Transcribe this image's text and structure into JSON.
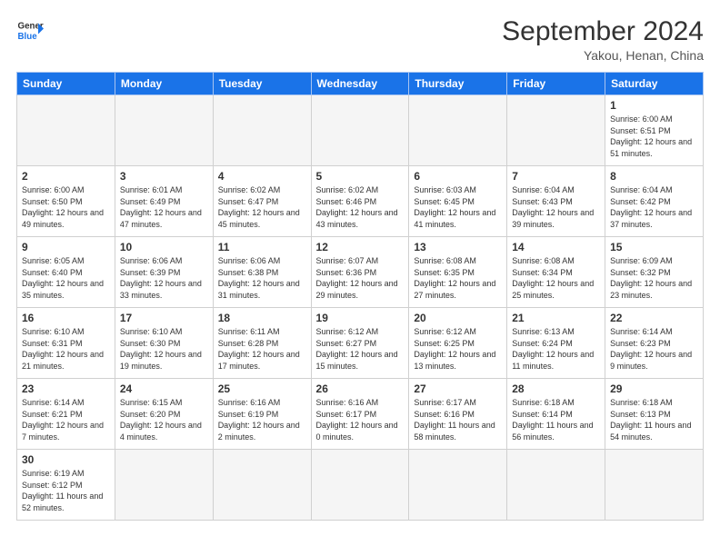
{
  "header": {
    "logo_line1": "General",
    "logo_line2": "Blue",
    "title": "September 2024",
    "subtitle": "Yakou, Henan, China"
  },
  "weekdays": [
    "Sunday",
    "Monday",
    "Tuesday",
    "Wednesday",
    "Thursday",
    "Friday",
    "Saturday"
  ],
  "days": [
    {
      "num": "",
      "empty": true
    },
    {
      "num": "",
      "empty": true
    },
    {
      "num": "",
      "empty": true
    },
    {
      "num": "",
      "empty": true
    },
    {
      "num": "",
      "empty": true
    },
    {
      "num": "",
      "empty": true
    },
    {
      "num": "1",
      "sunrise": "6:00 AM",
      "sunset": "6:51 PM",
      "daylight": "12 hours and 51 minutes."
    },
    {
      "num": "2",
      "sunrise": "6:00 AM",
      "sunset": "6:50 PM",
      "daylight": "12 hours and 49 minutes."
    },
    {
      "num": "3",
      "sunrise": "6:01 AM",
      "sunset": "6:49 PM",
      "daylight": "12 hours and 47 minutes."
    },
    {
      "num": "4",
      "sunrise": "6:02 AM",
      "sunset": "6:47 PM",
      "daylight": "12 hours and 45 minutes."
    },
    {
      "num": "5",
      "sunrise": "6:02 AM",
      "sunset": "6:46 PM",
      "daylight": "12 hours and 43 minutes."
    },
    {
      "num": "6",
      "sunrise": "6:03 AM",
      "sunset": "6:45 PM",
      "daylight": "12 hours and 41 minutes."
    },
    {
      "num": "7",
      "sunrise": "6:04 AM",
      "sunset": "6:43 PM",
      "daylight": "12 hours and 39 minutes."
    },
    {
      "num": "8",
      "sunrise": "6:04 AM",
      "sunset": "6:42 PM",
      "daylight": "12 hours and 37 minutes."
    },
    {
      "num": "9",
      "sunrise": "6:05 AM",
      "sunset": "6:40 PM",
      "daylight": "12 hours and 35 minutes."
    },
    {
      "num": "10",
      "sunrise": "6:06 AM",
      "sunset": "6:39 PM",
      "daylight": "12 hours and 33 minutes."
    },
    {
      "num": "11",
      "sunrise": "6:06 AM",
      "sunset": "6:38 PM",
      "daylight": "12 hours and 31 minutes."
    },
    {
      "num": "12",
      "sunrise": "6:07 AM",
      "sunset": "6:36 PM",
      "daylight": "12 hours and 29 minutes."
    },
    {
      "num": "13",
      "sunrise": "6:08 AM",
      "sunset": "6:35 PM",
      "daylight": "12 hours and 27 minutes."
    },
    {
      "num": "14",
      "sunrise": "6:08 AM",
      "sunset": "6:34 PM",
      "daylight": "12 hours and 25 minutes."
    },
    {
      "num": "15",
      "sunrise": "6:09 AM",
      "sunset": "6:32 PM",
      "daylight": "12 hours and 23 minutes."
    },
    {
      "num": "16",
      "sunrise": "6:10 AM",
      "sunset": "6:31 PM",
      "daylight": "12 hours and 21 minutes."
    },
    {
      "num": "17",
      "sunrise": "6:10 AM",
      "sunset": "6:30 PM",
      "daylight": "12 hours and 19 minutes."
    },
    {
      "num": "18",
      "sunrise": "6:11 AM",
      "sunset": "6:28 PM",
      "daylight": "12 hours and 17 minutes."
    },
    {
      "num": "19",
      "sunrise": "6:12 AM",
      "sunset": "6:27 PM",
      "daylight": "12 hours and 15 minutes."
    },
    {
      "num": "20",
      "sunrise": "6:12 AM",
      "sunset": "6:25 PM",
      "daylight": "12 hours and 13 minutes."
    },
    {
      "num": "21",
      "sunrise": "6:13 AM",
      "sunset": "6:24 PM",
      "daylight": "12 hours and 11 minutes."
    },
    {
      "num": "22",
      "sunrise": "6:14 AM",
      "sunset": "6:23 PM",
      "daylight": "12 hours and 9 minutes."
    },
    {
      "num": "23",
      "sunrise": "6:14 AM",
      "sunset": "6:21 PM",
      "daylight": "12 hours and 7 minutes."
    },
    {
      "num": "24",
      "sunrise": "6:15 AM",
      "sunset": "6:20 PM",
      "daylight": "12 hours and 4 minutes."
    },
    {
      "num": "25",
      "sunrise": "6:16 AM",
      "sunset": "6:19 PM",
      "daylight": "12 hours and 2 minutes."
    },
    {
      "num": "26",
      "sunrise": "6:16 AM",
      "sunset": "6:17 PM",
      "daylight": "12 hours and 0 minutes."
    },
    {
      "num": "27",
      "sunrise": "6:17 AM",
      "sunset": "6:16 PM",
      "daylight": "11 hours and 58 minutes."
    },
    {
      "num": "28",
      "sunrise": "6:18 AM",
      "sunset": "6:14 PM",
      "daylight": "11 hours and 56 minutes."
    },
    {
      "num": "29",
      "sunrise": "6:18 AM",
      "sunset": "6:13 PM",
      "daylight": "11 hours and 54 minutes."
    },
    {
      "num": "30",
      "sunrise": "6:19 AM",
      "sunset": "6:12 PM",
      "daylight": "11 hours and 52 minutes."
    },
    {
      "num": "",
      "empty": true
    },
    {
      "num": "",
      "empty": true
    },
    {
      "num": "",
      "empty": true
    },
    {
      "num": "",
      "empty": true
    },
    {
      "num": "",
      "empty": true
    }
  ]
}
